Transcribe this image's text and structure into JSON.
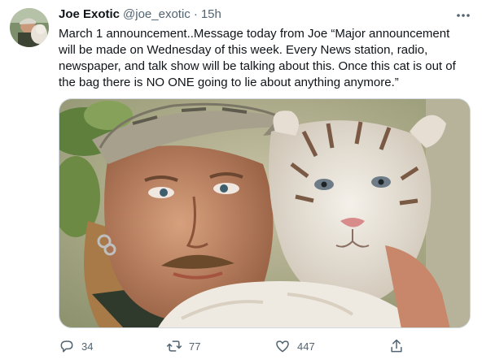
{
  "tweet": {
    "author": {
      "name": "Joe Exotic",
      "handle": "@joe_exotic",
      "separator": "·",
      "time": "15h"
    },
    "text_lines": [
      "March 1 announcement..Message today from Joe “Major announcement",
      "will be made on Wednesday of this week. Every News station, radio,",
      "newspaper, and talk show will be talking about this. Once this cat is out of",
      "the bag there is NO ONE going to lie about anything anymore.”"
    ],
    "actions": {
      "replies": "34",
      "retweets": "77",
      "likes": "447"
    }
  },
  "icons": {
    "more": "more-dots-icon",
    "reply": "reply-icon",
    "retweet": "retweet-icon",
    "like": "heart-icon",
    "share": "share-icon"
  },
  "colors": {
    "text": "#0f1419",
    "secondary": "#536471",
    "border": "#cfd9de"
  }
}
